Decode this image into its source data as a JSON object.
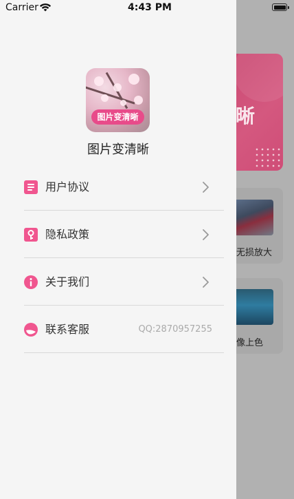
{
  "status_bar": {
    "carrier": "Carrier",
    "time": "4:43 PM"
  },
  "drawer": {
    "logo_badge": "图片变清晰",
    "app_name": "图片变清晰",
    "menu": [
      {
        "label": "用户协议",
        "icon": "document-icon"
      },
      {
        "label": "隐私政策",
        "icon": "privacy-lock-icon"
      },
      {
        "label": "关于我们",
        "icon": "info-icon"
      },
      {
        "label": "联系客服",
        "icon": "support-icon",
        "value": "QQ:2870957255"
      }
    ]
  },
  "background_page": {
    "banner_char": "晰",
    "card1_label": "无损放大",
    "card2_label": "像上色"
  },
  "colors": {
    "accent": "#f0568f",
    "drawer_bg": "#f5f5f5",
    "overlay_bg": "#b1b1b1"
  }
}
